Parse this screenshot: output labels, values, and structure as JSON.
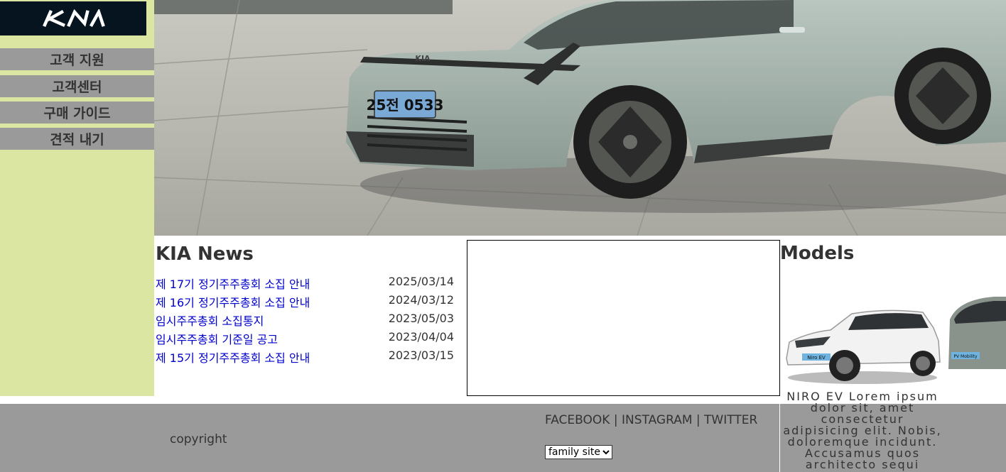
{
  "brand": {
    "logo_text": "KIA",
    "logo_bg": "#05141f"
  },
  "sidebar": {
    "bg": "#dbe6a2",
    "items": [
      {
        "label": "고객 지원"
      },
      {
        "label": "고객센터"
      },
      {
        "label": "구매 가이드"
      },
      {
        "label": "견적 내기"
      }
    ]
  },
  "hero": {
    "plate": "25전 0533",
    "car_badge": "KIA"
  },
  "news": {
    "title": "KIA News",
    "items": [
      {
        "title": "제 17기 정기주주총회 소집 안내",
        "date": "2025/03/14"
      },
      {
        "title": "제 16기 정기주주총회 소집 안내",
        "date": "2024/03/12"
      },
      {
        "title": "임시주주총회 소집통지",
        "date": "2023/05/03"
      },
      {
        "title": "임시주주총회 기준일 공고",
        "date": "2023/04/04"
      },
      {
        "title": "제 15기 정기주주총회 소집 안내",
        "date": "2023/03/15"
      }
    ]
  },
  "models": {
    "title": "Models",
    "caption": "NIRO EV Lorem ipsum dolor sit, amet consectetur adipisicing elit. Nobis, doloremque incidunt. Accusamus quos architecto sequi",
    "badge_1": "Niro EV",
    "badge_2": "PV Mobility"
  },
  "footer": {
    "copyright": "copyright",
    "social": {
      "facebook": "FACEBOOK",
      "instagram": "INSTAGRAM",
      "twitter": "TWITTER",
      "separator": "|"
    },
    "family_site": "family site"
  }
}
